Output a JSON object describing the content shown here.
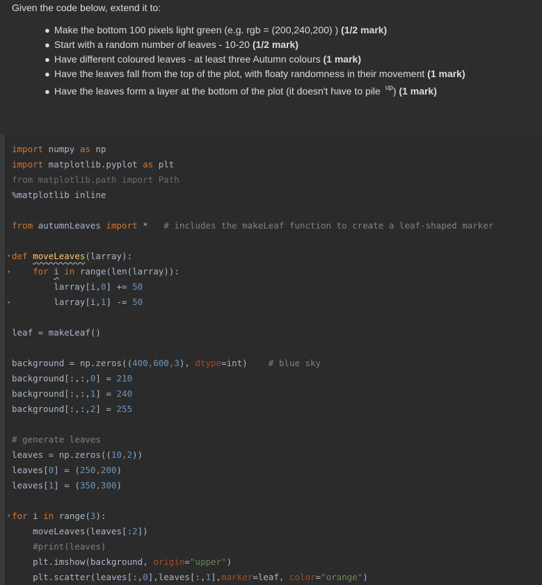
{
  "task": {
    "title": "Given the code below, extend it to:",
    "items": [
      {
        "text": "Make the bottom 100 pixels light green (e.g. rgb = (200,240,200) ) ",
        "mark": "(1/2 mark)"
      },
      {
        "text": "Start with a random number of leaves - 10-20 ",
        "mark": "(1/2 mark)"
      },
      {
        "text": "Have different coloured leaves - at least three Autumn colours ",
        "mark": "(1 mark)"
      },
      {
        "text": "Have the leaves fall from the top of the plot, with floaty randomness in their movement ",
        "mark": "(1 mark)"
      },
      {
        "text": "Have the leaves form a layer at the bottom of the plot (it doesn't have to pile ",
        "sup": "up",
        "tail": ")",
        "mark": " (1 mark)"
      }
    ]
  },
  "code": {
    "l1": {
      "a": "import",
      "b": " numpy ",
      "c": "as",
      "d": " np"
    },
    "l2": {
      "a": "import",
      "b": " matplotlib.pyplot ",
      "c": "as",
      "d": " plt"
    },
    "l3": {
      "a": "from matplotlib.path import Path"
    },
    "l4": {
      "a": "%matplotlib inline"
    },
    "l5": {
      "a": "from",
      "b": " autumnLeaves ",
      "c": "import",
      "d": " *   ",
      "e": "# includes the makeLeaf function to create a leaf-shaped marker"
    },
    "l6": {
      "a": "def",
      "b": " ",
      "c": "moveLeaves",
      "d": "(larray):"
    },
    "l7": {
      "a": "    ",
      "b": "for",
      "c": " ",
      "d": "i",
      "e": " ",
      "f": "in",
      "g": " range(len(larray)):"
    },
    "l8": {
      "a": "        larray[i,",
      "b": "0",
      "c": "] += ",
      "d": "50"
    },
    "l9": {
      "a": "        larray[i,",
      "b": "1",
      "c": "] -= ",
      "d": "50"
    },
    "l10": {
      "a": "leaf = makeLeaf()"
    },
    "l11": {
      "a": "background = np.zeros((",
      "b": "400",
      "c": ",",
      "d": "600",
      "e": ",",
      "f": "3",
      "g": "), ",
      "h": "dtype",
      "i": "=int)    ",
      "j": "# blue sky"
    },
    "l12": {
      "a": "background[:,:,",
      "b": "0",
      "c": "] = ",
      "d": "210"
    },
    "l13": {
      "a": "background[:,:,",
      "b": "1",
      "c": "] = ",
      "d": "240"
    },
    "l14": {
      "a": "background[:,:,",
      "b": "2",
      "c": "] = ",
      "d": "255"
    },
    "l15": {
      "a": "# generate leaves"
    },
    "l16": {
      "a": "leaves = np.zeros((",
      "b": "10",
      "c": ",",
      "d": "2",
      "e": "))"
    },
    "l17": {
      "a": "leaves[",
      "b": "0",
      "c": "] = (",
      "d": "250",
      "e": ",",
      "f": "200",
      "g": ")"
    },
    "l18": {
      "a": "leaves[",
      "b": "1",
      "c": "] = (",
      "d": "350",
      "e": ",",
      "f": "300",
      "g": ")"
    },
    "l19": {
      "a": "for",
      "b": " i ",
      "c": "in",
      "d": " range(",
      "e": "3",
      "f": "):"
    },
    "l20": {
      "a": "    moveLeaves(leaves[:",
      "b": "2",
      "c": "])"
    },
    "l21": {
      "a": "    #print(leaves)"
    },
    "l22": {
      "a": "    plt.imshow(background, ",
      "b": "origin",
      "c": "=",
      "d": "\"upper\"",
      "e": ")"
    },
    "l23": {
      "a": "    plt.scatter(leaves[:,",
      "b": "0",
      "c": "],leaves[:,",
      "d": "1",
      "e": "],",
      "f": "marker",
      "g": "=leaf, ",
      "h": "color",
      "i": "=",
      "j": "\"orange\"",
      "k": ")"
    }
  }
}
